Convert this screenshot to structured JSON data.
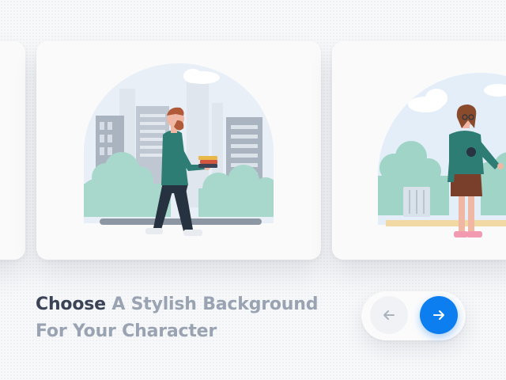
{
  "headline": {
    "emphasis": "Choose",
    "rest": "A Stylish Background For Your Character"
  },
  "carousel": {
    "cards": [
      {
        "scene": "city-park",
        "illustration": "man-carrying-books"
      },
      {
        "scene": "garden",
        "illustration": "woman-with-glasses"
      }
    ]
  },
  "navigation": {
    "prev_icon": "arrow-left-icon",
    "next_icon": "arrow-right-icon"
  },
  "colors": {
    "accent": "#0d7ef0",
    "headline_dark": "#3a4456",
    "headline_light": "#9aa3b2",
    "sky": "#e3eef8",
    "foliage": "#9fd4c7",
    "shirt": "#2d7d74"
  }
}
